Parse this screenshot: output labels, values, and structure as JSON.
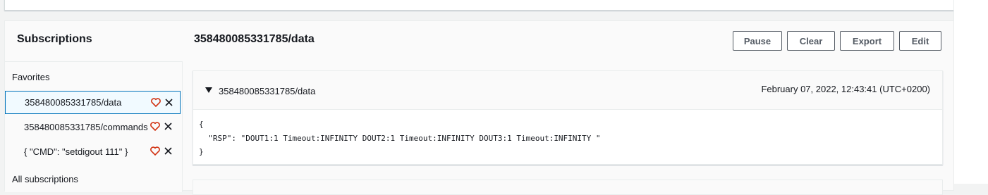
{
  "subscriptions": {
    "title": "Subscriptions",
    "favorites_heading": "Favorites",
    "favorites": [
      {
        "label": "358480085331785/data",
        "selected": true
      },
      {
        "label": "358480085331785/commands",
        "selected": false
      },
      {
        "label": "{ \"CMD\": \"setdigout 111\" }",
        "selected": false
      }
    ],
    "all_heading": "All subscriptions"
  },
  "main": {
    "topic_title": "358480085331785/data",
    "buttons": {
      "pause": "Pause",
      "clear": "Clear",
      "export": "Export",
      "edit": "Edit"
    },
    "message": {
      "topic": "358480085331785/data",
      "timestamp": "February 07, 2022, 12:43:41 (UTC+0200)",
      "payload_lines": [
        "{",
        "  \"RSP\": \"DOUT1:1 Timeout:INFINITY DOUT2:1 Timeout:INFINITY DOUT3:1 Timeout:INFINITY \"",
        "}"
      ]
    }
  },
  "icons": {
    "heart": "heart-outline-icon",
    "close": "close-icon",
    "caret": "caret-down-icon"
  },
  "colors": {
    "accent": "#0073bb",
    "heart": "#d13212",
    "text": "#16191f",
    "button_border": "#545b64"
  }
}
